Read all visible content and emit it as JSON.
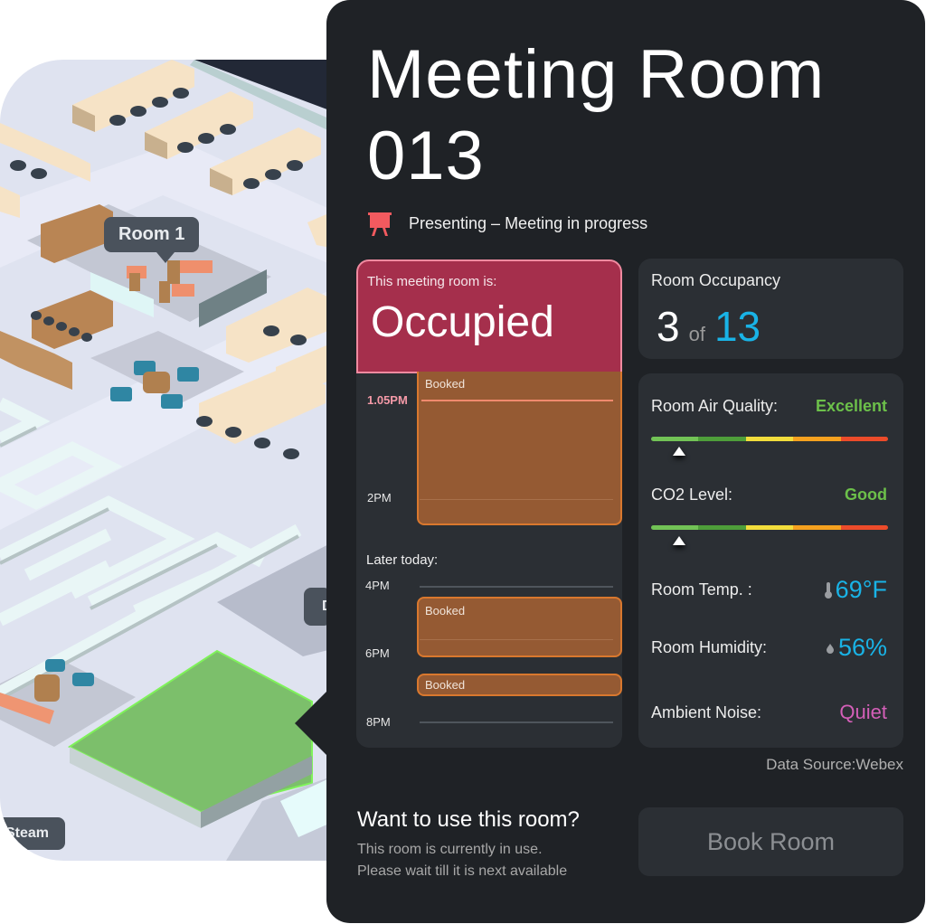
{
  "map": {
    "labels": {
      "room1": "Room 1",
      "steam": "Steam",
      "partial": "D"
    }
  },
  "panel": {
    "title": "Meeting Room 013",
    "status": {
      "icon": "presentation-easel-icon",
      "text": "Presenting – Meeting in progress",
      "icon_color": "#f25a5f"
    },
    "room_state": {
      "label": "This meeting room is:",
      "value": "Occupied",
      "color": "#a52f4c"
    },
    "schedule": {
      "current": {
        "now_label": "1.05PM",
        "time_labels": [
          "2PM"
        ],
        "booking": {
          "label": "Booked"
        }
      },
      "later_label": "Later today:",
      "later_time_labels": [
        "4PM",
        "6PM",
        "8PM"
      ],
      "later_bookings": [
        {
          "label": "Booked"
        },
        {
          "label": "Booked"
        }
      ]
    },
    "occupancy": {
      "label": "Room Occupancy",
      "current": "3",
      "of_label": "of",
      "capacity": "13"
    },
    "environment": {
      "air_quality": {
        "label": "Room Air Quality:",
        "value": "Excellent",
        "scale_position": 0.12
      },
      "co2": {
        "label": "CO2 Level:",
        "value": "Good",
        "scale_position": 0.12
      },
      "temperature": {
        "label": "Room Temp. :",
        "value": "69°F",
        "icon": "thermometer-icon"
      },
      "humidity": {
        "label": "Room Humidity:",
        "value": "56%",
        "icon": "droplet-icon"
      },
      "noise": {
        "label": "Ambient Noise:",
        "value": "Quiet"
      },
      "scale_colors": [
        "#72c356",
        "#4e9e3a",
        "#f2dd3c",
        "#f5a11f",
        "#ec4b2a"
      ]
    },
    "data_source": "Data Source:Webex",
    "cta": {
      "title": "Want to use this room?",
      "line1": "This room is currently in use.",
      "line2": "Please wait till it is next available",
      "button": "Book Room"
    }
  }
}
